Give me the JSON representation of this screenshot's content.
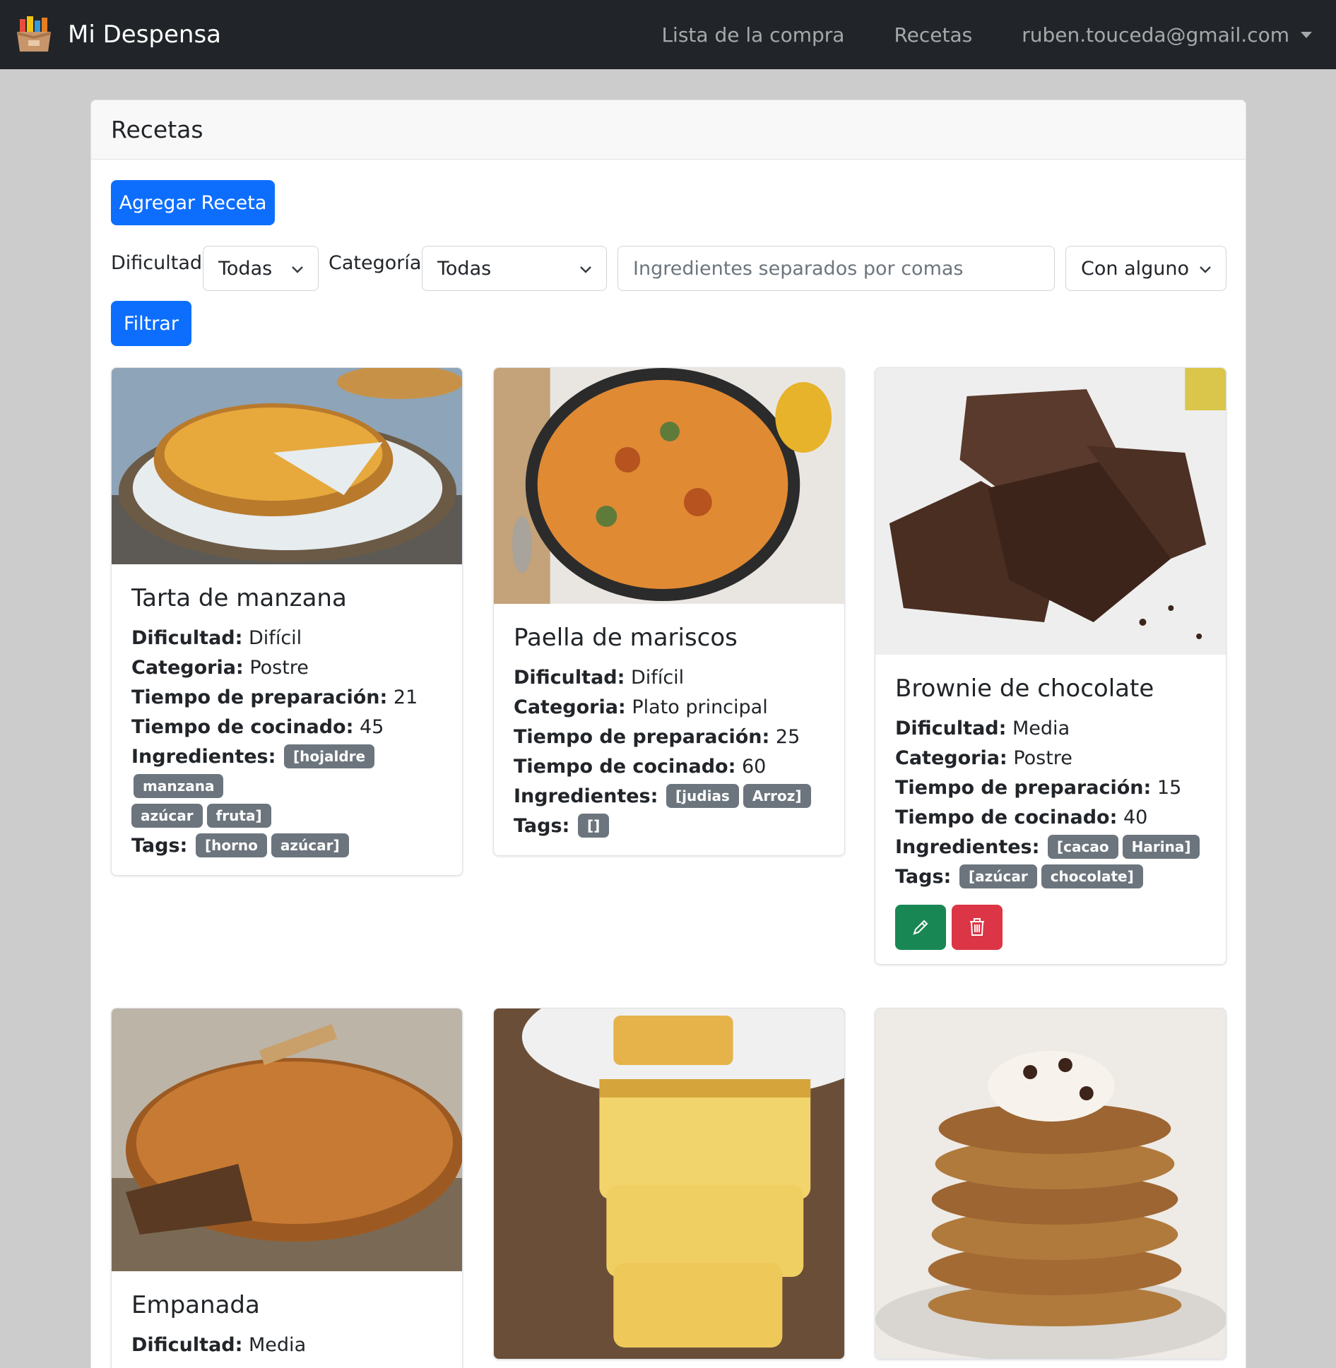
{
  "navbar": {
    "brand": "Mi Despensa",
    "links": [
      "Lista de la compra",
      "Recetas"
    ],
    "user": "ruben.touceda@gmail.com"
  },
  "page": {
    "title": "Recetas",
    "add_button": "Agregar Receta",
    "filter_button": "Filtrar"
  },
  "filters": {
    "difficulty_label": "Dificultad:",
    "difficulty_value": "Todas",
    "category_label": "Categoría:",
    "category_value": "Todas",
    "ingredients_placeholder": "Ingredientes separados por comas",
    "match_value": "Con alguno"
  },
  "labels": {
    "difficulty": "Dificultad:",
    "category": "Categoria:",
    "prep_time": "Tiempo de preparación:",
    "cook_time": "Tiempo de cocinado:",
    "ingredients": "Ingredientes:",
    "tags": "Tags:"
  },
  "recipes": [
    {
      "title": "Tarta de manzana",
      "difficulty": "Difícil",
      "category": "Postre",
      "prep_time": "21",
      "cook_time": "45",
      "ingredients": [
        "[hojaldre",
        "manzana",
        "azúcar",
        "fruta]"
      ],
      "tags": [
        "[horno",
        "azúcar]"
      ],
      "image_icon": "apple-tart-photo"
    },
    {
      "title": "Paella de mariscos",
      "difficulty": "Difícil",
      "category": "Plato principal",
      "prep_time": "25",
      "cook_time": "60",
      "ingredients": [
        "[judias",
        "Arroz]"
      ],
      "tags": [
        "[]"
      ],
      "image_icon": "paella-photo"
    },
    {
      "title": "Brownie de chocolate",
      "difficulty": "Media",
      "category": "Postre",
      "prep_time": "15",
      "cook_time": "40",
      "ingredients": [
        "[cacao",
        "Harina]"
      ],
      "tags": [
        "[azúcar",
        "chocolate]"
      ],
      "image_icon": "brownie-photo"
    },
    {
      "title": "Empanada",
      "difficulty": "Media",
      "image_icon": "empanada-photo"
    },
    {
      "image_icon": "sponge-cake-photo"
    },
    {
      "image_icon": "pancakes-photo"
    }
  ],
  "colors": {
    "navbar": "#212529",
    "primary": "#0d6efd",
    "success": "#198754",
    "danger": "#dc3545",
    "badge": "#6c757d"
  }
}
